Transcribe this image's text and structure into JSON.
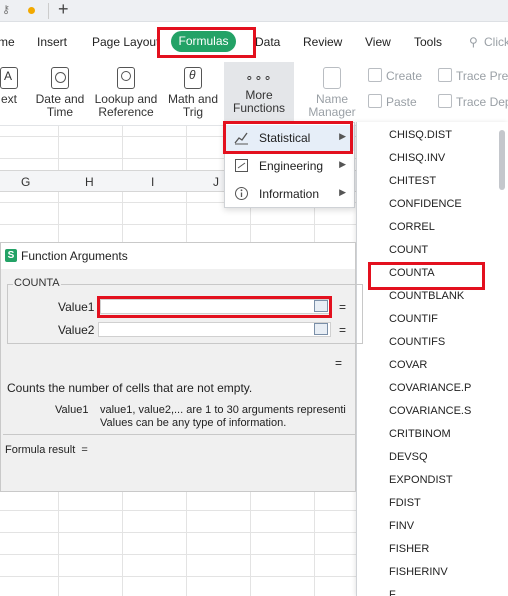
{
  "tabbar": {
    "new_tab": "+"
  },
  "menu": {
    "home": "me",
    "insert": "Insert",
    "page_layout": "Page Layout",
    "formulas": "Formulas",
    "data": "Data",
    "review": "Review",
    "view": "View",
    "tools": "Tools",
    "search": "Click"
  },
  "ribbon": {
    "text": [
      "ext"
    ],
    "date_time": [
      "Date and",
      "Time"
    ],
    "lookup_reference": [
      "Lookup and",
      "Reference"
    ],
    "math_trig": [
      "Math and",
      "Trig"
    ],
    "more_functions": [
      "More",
      "Functions"
    ],
    "name_manager": [
      "Name",
      "Manager"
    ],
    "create": "Create",
    "paste": "Paste",
    "trace_precedents": "Trace Prec",
    "trace_dependents": "Trace Dep"
  },
  "columns": [
    "G",
    "H",
    "I",
    "J"
  ],
  "more_functions_menu": [
    {
      "label": "Statistical",
      "icon": "chart-icon"
    },
    {
      "label": "Engineering",
      "icon": "engineering-icon"
    },
    {
      "label": "Information",
      "icon": "info-icon"
    }
  ],
  "function_list": [
    "CHISQ.DIST",
    "CHISQ.INV",
    "CHITEST",
    "CONFIDENCE",
    "CORREL",
    "COUNT",
    "COUNTA",
    "COUNTBLANK",
    "COUNTIF",
    "COUNTIFS",
    "COVAR",
    "COVARIANCE.P",
    "COVARIANCE.S",
    "CRITBINOM",
    "DEVSQ",
    "EXPONDIST",
    "FDIST",
    "FINV",
    "FISHER",
    "FISHERINV",
    "F"
  ],
  "dialog": {
    "logo": "S",
    "title": "Function Arguments",
    "group": "COUNTA",
    "value1_label": "Value1",
    "value2_label": "Value2",
    "equals": "=",
    "value1_value": "",
    "value2_value": "",
    "description": "Counts the number of cells that are not empty.",
    "arg_name": "Value1",
    "arg_desc_line1": "value1, value2,... are 1 to 30 arguments representi",
    "arg_desc_line2": "Values can be any type of information.",
    "formula_result": "Formula result  ="
  },
  "colors": {
    "accent": "#23a266",
    "highlight": "#e3101e"
  }
}
